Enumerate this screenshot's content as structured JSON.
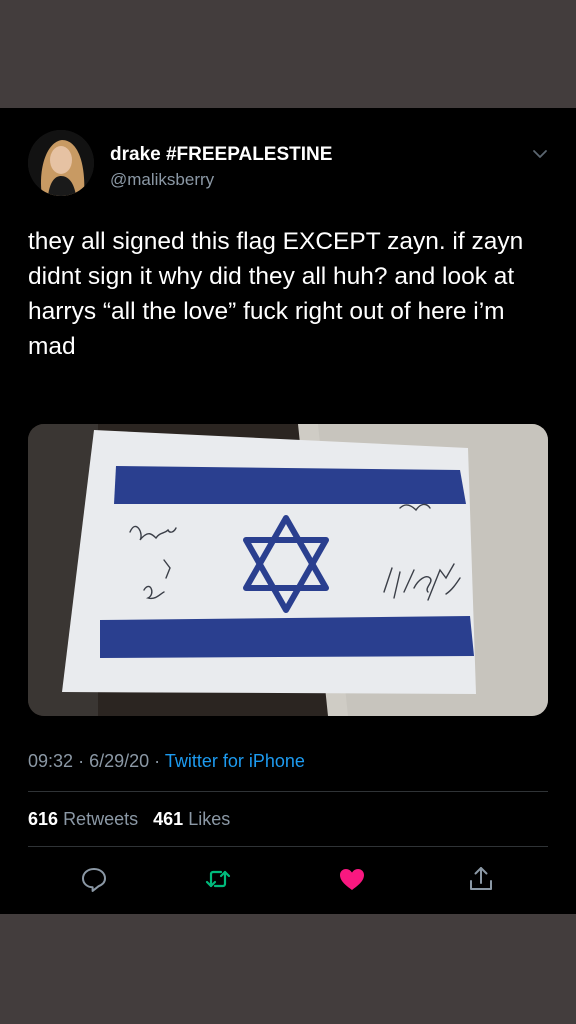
{
  "tweet": {
    "display_name": "drake #FREEPALESTINE",
    "handle": "@maliksberry",
    "text": "they all signed this flag EXCEPT zayn. if zayn didnt sign it why did they all huh? and look at harrys “all the love” fuck right out of here i’m mad",
    "time": "09:32",
    "date": "6/29/20",
    "separator": "·",
    "source": "Twitter for iPhone",
    "retweets_count": "616",
    "retweets_label": "Retweets",
    "likes_count": "461",
    "likes_label": "Likes"
  },
  "icons": {
    "menu": "chevron-down-icon",
    "reply": "reply-icon",
    "retweet": "retweet-icon",
    "like": "heart-icon",
    "share": "share-icon"
  },
  "colors": {
    "background": "#433d3d",
    "card": "#000000",
    "text": "#ffffff",
    "secondary": "#8b98a5",
    "link": "#1d9bf0",
    "retweet": "#00ba7c",
    "like": "#f91880",
    "flag_blue": "#2a3f8f"
  }
}
